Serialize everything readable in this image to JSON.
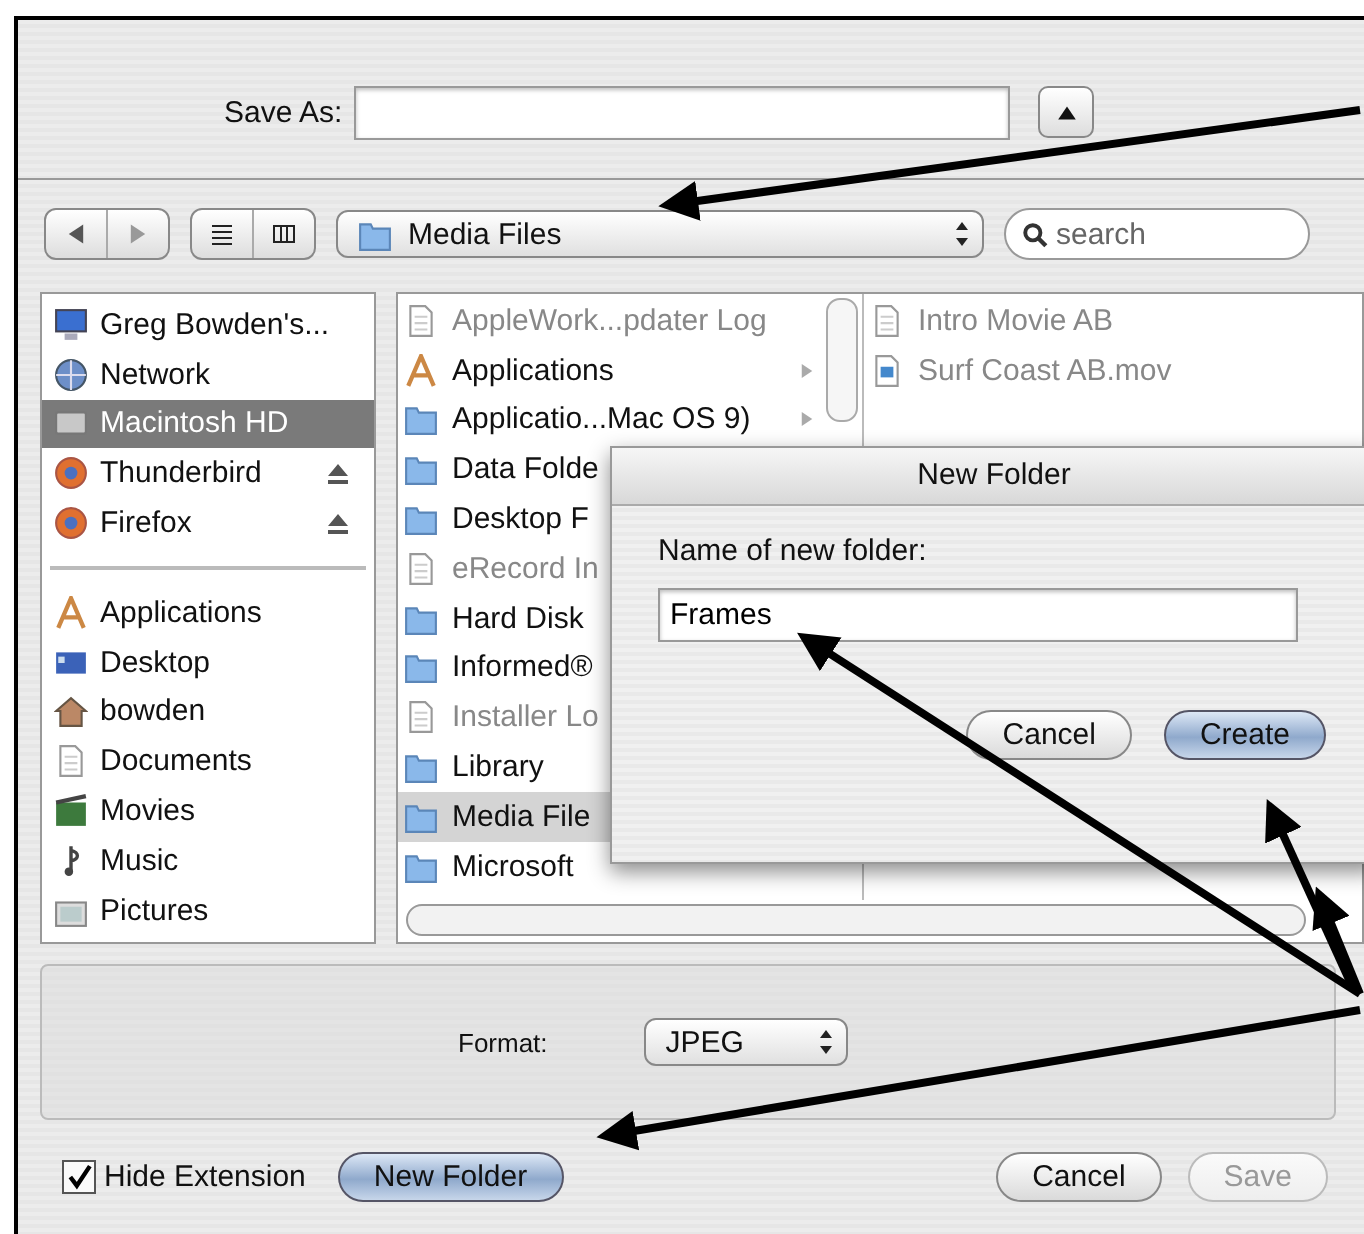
{
  "save_as": {
    "label": "Save As:"
  },
  "location": {
    "folder": "Media Files"
  },
  "search": {
    "placeholder": "search"
  },
  "sidebar": {
    "devices": [
      {
        "label": "Greg Bowden's...",
        "kind": "computer",
        "selected": false,
        "ejectable": false
      },
      {
        "label": "Network",
        "kind": "globe",
        "selected": false,
        "ejectable": false
      },
      {
        "label": "Macintosh HD",
        "kind": "drive",
        "selected": true,
        "ejectable": false
      },
      {
        "label": "Thunderbird",
        "kind": "app",
        "selected": false,
        "ejectable": true
      },
      {
        "label": "Firefox",
        "kind": "app",
        "selected": false,
        "ejectable": true
      }
    ],
    "places": [
      {
        "label": "Applications",
        "kind": "applications",
        "selected": false,
        "ejectable": false
      },
      {
        "label": "Desktop",
        "kind": "desktop",
        "selected": false,
        "ejectable": false
      },
      {
        "label": "bowden",
        "kind": "home",
        "selected": false,
        "ejectable": false
      },
      {
        "label": "Documents",
        "kind": "document",
        "selected": false,
        "ejectable": false
      },
      {
        "label": "Movies",
        "kind": "film",
        "selected": false,
        "ejectable": false
      },
      {
        "label": "Music",
        "kind": "music",
        "selected": false,
        "ejectable": false
      },
      {
        "label": "Pictures",
        "kind": "picture",
        "selected": false,
        "ejectable": false
      }
    ]
  },
  "column_1": [
    {
      "label": "AppleWork...pdater Log",
      "kind": "document",
      "dimmed": true,
      "selected": false,
      "has_children": false
    },
    {
      "label": "Applications",
      "kind": "applications",
      "dimmed": false,
      "selected": false,
      "has_children": true
    },
    {
      "label": "Applicatio...Mac OS 9)",
      "kind": "folder",
      "dimmed": false,
      "selected": false,
      "has_children": true
    },
    {
      "label": "Data Folde",
      "kind": "folder",
      "dimmed": false,
      "selected": false
    },
    {
      "label": "Desktop F",
      "kind": "folder",
      "dimmed": false,
      "selected": false
    },
    {
      "label": "eRecord In",
      "kind": "document",
      "dimmed": true,
      "selected": false
    },
    {
      "label": "Hard Disk",
      "kind": "folder",
      "dimmed": false,
      "selected": false
    },
    {
      "label": "Informed®",
      "kind": "folder",
      "dimmed": false,
      "selected": false
    },
    {
      "label": "Installer Lo",
      "kind": "document",
      "dimmed": true,
      "selected": false
    },
    {
      "label": "Library",
      "kind": "folder",
      "dimmed": false,
      "selected": false
    },
    {
      "label": "Media File",
      "kind": "folder",
      "dimmed": false,
      "selected": true
    },
    {
      "label": "Microsoft",
      "kind": "folder",
      "dimmed": false,
      "selected": false
    }
  ],
  "column_2": [
    {
      "label": "Intro Movie AB",
      "kind": "document",
      "dimmed": true
    },
    {
      "label": "Surf Coast AB.mov",
      "kind": "movie",
      "dimmed": true
    }
  ],
  "format": {
    "label": "Format:",
    "value": "JPEG"
  },
  "hide_extension": {
    "label": "Hide Extension",
    "checked": true
  },
  "buttons": [
    {
      "label": "New Folder",
      "kind": "default",
      "disabled": false
    },
    {
      "label": "Cancel",
      "kind": "normal",
      "disabled": false
    },
    {
      "label": "Save",
      "kind": "normal",
      "disabled": true
    }
  ],
  "new_folder_sheet": {
    "title": "New Folder",
    "prompt": "Name of new folder:",
    "value": "Frames",
    "buttons": [
      {
        "label": "Cancel",
        "kind": "normal"
      },
      {
        "label": "Create",
        "kind": "default"
      }
    ]
  }
}
